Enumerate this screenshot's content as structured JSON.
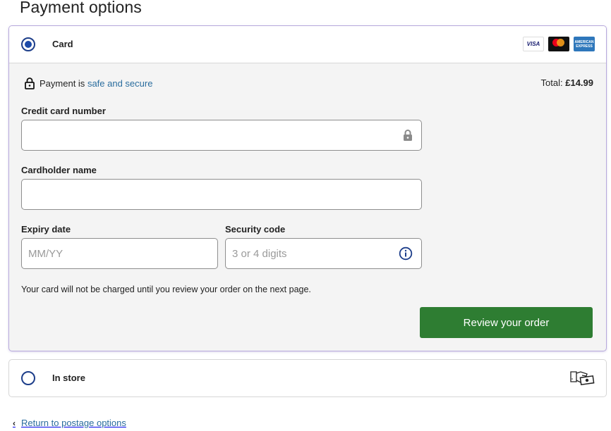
{
  "page": {
    "title": "Payment options"
  },
  "card_option": {
    "label": "Card",
    "selected": true,
    "logos": [
      {
        "name": "visa",
        "text": "VISA"
      },
      {
        "name": "mastercard",
        "text": "mastercard"
      },
      {
        "name": "amex",
        "text": "AMERICAN EXPRESS"
      }
    ],
    "secure_prefix": "Payment is ",
    "secure_link": "safe and secure",
    "total_label": "Total: ",
    "total_value": "£14.99",
    "fields": {
      "card_number": {
        "label": "Credit card number",
        "value": "",
        "placeholder": ""
      },
      "cardholder": {
        "label": "Cardholder name",
        "value": "",
        "placeholder": ""
      },
      "expiry": {
        "label": "Expiry date",
        "value": "",
        "placeholder": "MM/YY"
      },
      "security": {
        "label": "Security code",
        "value": "",
        "placeholder": "3 or 4 digits"
      }
    },
    "note": "Your card will not be charged until you review your order on the next page.",
    "review_button": "Review your order",
    "colors": {
      "accent": "#2e7d32",
      "radio": "#1c4aa8",
      "link": "#2a6d9e"
    }
  },
  "store_option": {
    "label": "In store",
    "selected": false
  },
  "back_link": "Return to postage options"
}
